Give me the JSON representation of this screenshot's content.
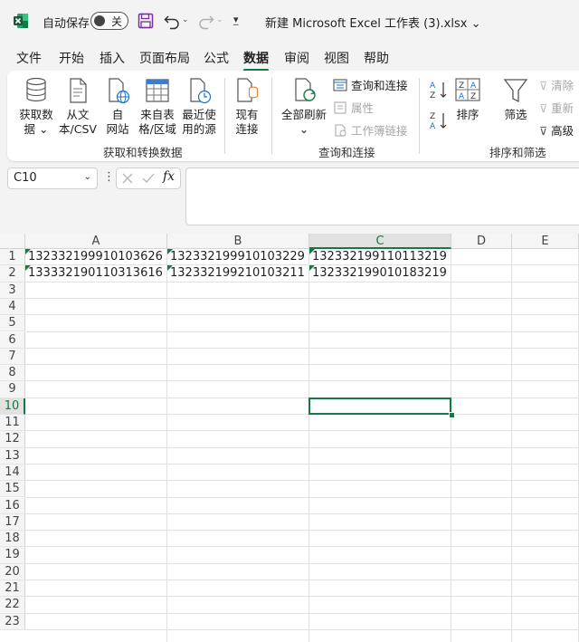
{
  "titlebar": {
    "autosave_label": "自动保存",
    "autosave_state": "关",
    "document_title": "新建 Microsoft Excel 工作表 (3).xlsx ⌄"
  },
  "tabs": [
    {
      "label": "文件"
    },
    {
      "label": "开始"
    },
    {
      "label": "插入"
    },
    {
      "label": "页面布局"
    },
    {
      "label": "公式"
    },
    {
      "label": "数据"
    },
    {
      "label": "审阅"
    },
    {
      "label": "视图"
    },
    {
      "label": "帮助"
    }
  ],
  "active_tab": "数据",
  "ribbon": {
    "get_data": {
      "line1": "获取数",
      "line2": "据 ⌄"
    },
    "from_text_csv": {
      "line1": "从文",
      "line2": "本/CSV"
    },
    "from_web": {
      "line1": "自",
      "line2": "网站"
    },
    "from_table": {
      "line1": "来自表",
      "line2": "格/区域"
    },
    "recent_sources": {
      "line1": "最近使",
      "line2": "用的源"
    },
    "existing_connections": {
      "line1": "现有",
      "line2": "连接"
    },
    "group1_label": "获取和转换数据",
    "refresh_all": {
      "line1": "全部刷新",
      "line2": "⌄"
    },
    "queries_connections": "查询和连接",
    "properties": "属性",
    "edit_links": "工作簿链接",
    "group2_label": "查询和连接",
    "sort": "排序",
    "filter": "筛选",
    "clear": "清除",
    "reapply": "重新",
    "advanced": "高级",
    "group3_label": "排序和筛选"
  },
  "formula_bar": {
    "name_box": "C10",
    "fx": "fx",
    "formula": ""
  },
  "sheet": {
    "columns": [
      "A",
      "B",
      "C",
      "D",
      "E"
    ],
    "selected_column": "C",
    "rows": [
      "1",
      "2",
      "3",
      "4",
      "5",
      "6",
      "7",
      "8",
      "9",
      "10",
      "11",
      "12",
      "13",
      "14",
      "15",
      "16",
      "17",
      "18",
      "19",
      "20",
      "21",
      "22",
      "23"
    ],
    "selected_row": "10",
    "cells": {
      "A1": "132332199910103626",
      "B1": "132332199910103229",
      "C1": "132332199110113219",
      "A2": "133332190110313616",
      "B2": "132332199210103211",
      "C2": "132332199010183219"
    }
  },
  "colors": {
    "accent": "#107c41",
    "excel_green": "#107c41",
    "save_purple": "#7a2ea0"
  }
}
